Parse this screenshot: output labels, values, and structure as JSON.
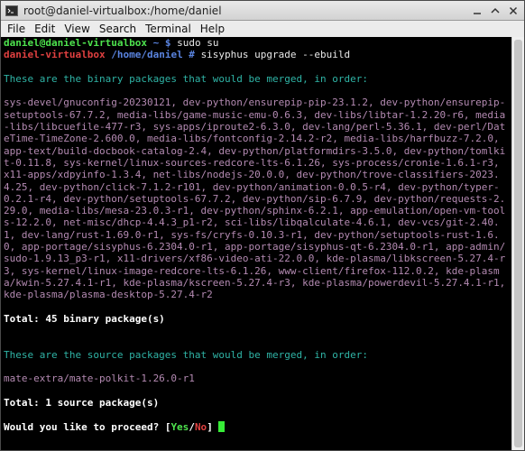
{
  "window": {
    "title": "root@daniel-virtualbox:/home/daniel"
  },
  "menu": {
    "items": [
      "File",
      "Edit",
      "View",
      "Search",
      "Terminal",
      "Help"
    ]
  },
  "terminal": {
    "prompt1": {
      "userhost": "daniel@daniel-virtualbox",
      "path": "~ $",
      "command": "sudo su"
    },
    "prompt2": {
      "host": "daniel-virtualbox",
      "path": "/home/daniel #",
      "command": "sisyphus upgrade --ebuild"
    },
    "binary_header": "These are the binary packages that would be merged, in order:",
    "binary_packages": "sys-devel/gnuconfig-20230121, dev-python/ensurepip-pip-23.1.2, dev-python/ensurepip-setuptools-67.7.2, media-libs/game-music-emu-0.6.3, dev-libs/libtar-1.2.20-r6, media-libs/libcuefile-477-r3, sys-apps/iproute2-6.3.0, dev-lang/perl-5.36.1, dev-perl/DateTime-TimeZone-2.600.0, media-libs/fontconfig-2.14.2-r2, media-libs/harfbuzz-7.2.0, app-text/build-docbook-catalog-2.4, dev-python/platformdirs-3.5.0, dev-python/tomlkit-0.11.8, sys-kernel/linux-sources-redcore-lts-6.1.26, sys-process/cronie-1.6.1-r3, x11-apps/xdpyinfo-1.3.4, net-libs/nodejs-20.0.0, dev-python/trove-classifiers-2023.4.25, dev-python/click-7.1.2-r101, dev-python/animation-0.0.5-r4, dev-python/typer-0.2.1-r4, dev-python/setuptools-67.7.2, dev-python/sip-6.7.9, dev-python/requests-2.29.0, media-libs/mesa-23.0.3-r1, dev-python/sphinx-6.2.1, app-emulation/open-vm-tools-12.2.0, net-misc/dhcp-4.4.3_p1-r2, sci-libs/libqalculate-4.6.1, dev-vcs/git-2.40.1, dev-lang/rust-1.69.0-r1, sys-fs/cryfs-0.10.3-r1, dev-python/setuptools-rust-1.6.0, app-portage/sisyphus-6.2304.0-r1, app-portage/sisyphus-qt-6.2304.0-r1, app-admin/sudo-1.9.13_p3-r1, x11-drivers/xf86-video-ati-22.0.0, kde-plasma/libkscreen-5.27.4-r3, sys-kernel/linux-image-redcore-lts-6.1.26, www-client/firefox-112.0.2, kde-plasma/kwin-5.27.4.1-r1, kde-plasma/kscreen-5.27.4-r3, kde-plasma/powerdevil-5.27.4.1-r1, kde-plasma/plasma-desktop-5.27.4-r2",
    "binary_total": "Total: 45 binary package(s)",
    "source_header": "These are the source packages that would be merged, in order:",
    "source_packages": "mate-extra/mate-polkit-1.26.0-r1",
    "source_total": "Total: 1 source package(s)",
    "proceed": {
      "question": "Would you like to proceed? ",
      "open_bracket": "[",
      "yes": "Yes",
      "slash": "/",
      "no": "No",
      "close_bracket": "]"
    }
  },
  "colors": {
    "prompt_user": "#4ee44e",
    "prompt_root": "#e04040",
    "prompt_path": "#5a84e0",
    "header_teal": "#2fb4a6",
    "packages_pink": "#b48ab2",
    "cursor": "#37ec37"
  },
  "icons": [
    "terminal-icon",
    "minimize-icon",
    "maximize-icon",
    "close-icon"
  ]
}
